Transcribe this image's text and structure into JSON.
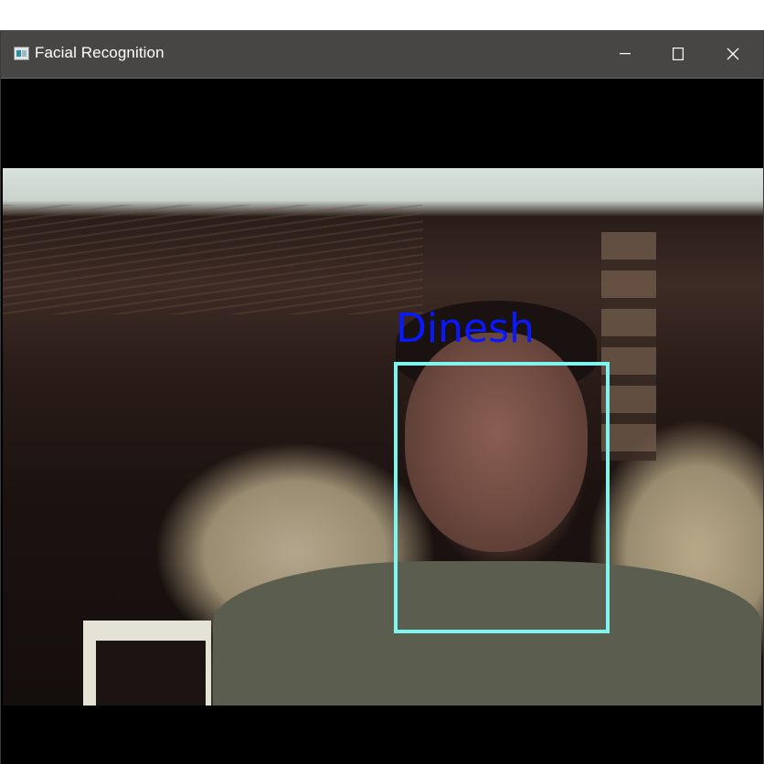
{
  "window": {
    "title": "Facial Recognition",
    "controls": {
      "minimize": "minimize-icon",
      "maximize": "maximize-icon",
      "close": "close-icon"
    }
  },
  "detection": {
    "label": "Dinesh",
    "label_color": "#0a18ff",
    "box_color": "#7ff5f0"
  }
}
